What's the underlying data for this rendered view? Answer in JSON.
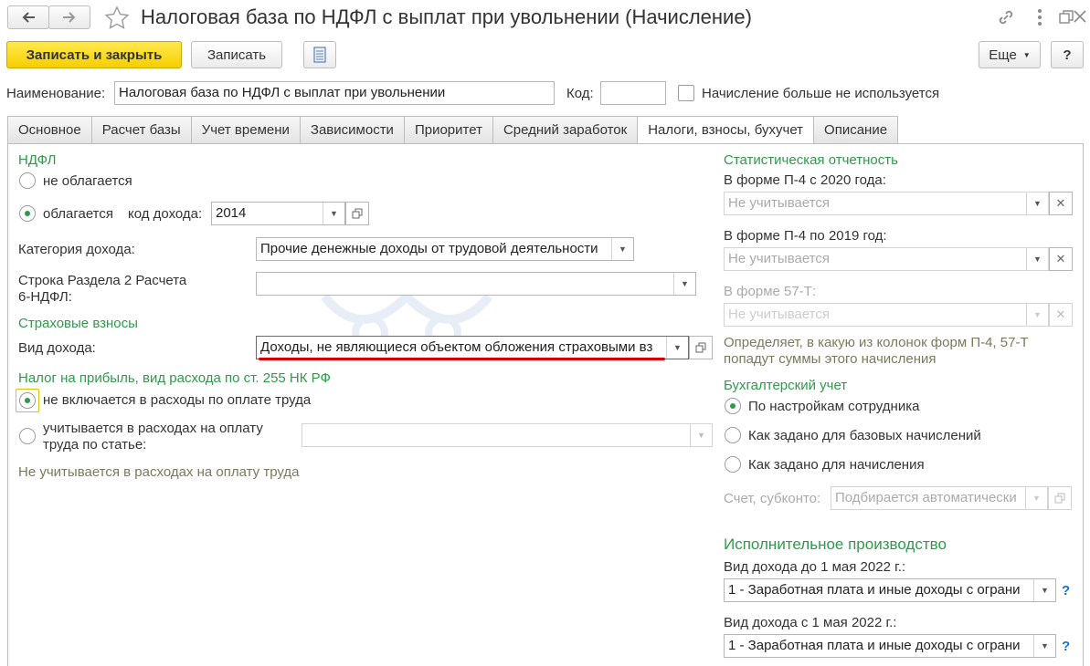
{
  "window": {
    "title": "Налоговая база по НДФЛ с выплат при увольнении (Начисление)",
    "back_icon": "arrow-left-icon",
    "forward_icon": "arrow-right-icon",
    "star_icon": "star-icon",
    "link_icon": "link-icon",
    "menu_icon": "more-vertical-icon",
    "restore_icon": "restore-icon",
    "close_icon": "close-icon"
  },
  "toolbar": {
    "save_close_label": "Записать и закрыть",
    "save_label": "Записать",
    "report_icon": "document-list-icon",
    "more_label": "Еще",
    "help_label": "?"
  },
  "header": {
    "name_label": "Наименование:",
    "name_value": "Налоговая база по НДФЛ с выплат при увольнении",
    "code_label": "Код:",
    "code_value": "",
    "unused_label": "Начисление больше не используется"
  },
  "tabs": [
    {
      "label": "Основное"
    },
    {
      "label": "Расчет базы"
    },
    {
      "label": "Учет времени"
    },
    {
      "label": "Зависимости"
    },
    {
      "label": "Приоритет"
    },
    {
      "label": "Средний заработок"
    },
    {
      "label": "Налоги, взносы, бухучет"
    },
    {
      "label": "Описание"
    }
  ],
  "ndfl": {
    "section": "НДФЛ",
    "not_taxed_label": "не облагается",
    "taxed_label": "облагается",
    "income_code_label": "код дохода:",
    "income_code_value": "2014",
    "category_label": "Категория дохода:",
    "category_value": "Прочие денежные доходы от трудовой деятельности",
    "row_label_1": "Строка Раздела 2 Расчета",
    "row_label_2": "6-НДФЛ:",
    "row_value": ""
  },
  "insurance": {
    "section": "Страховые взносы",
    "income_type_label": "Вид дохода:",
    "income_type_value": "Доходы, не являющиеся объектом обложения страховыми вз"
  },
  "profit_tax": {
    "section": "Налог на прибыль, вид расхода по ст. 255 НК РФ",
    "not_included_label": "не включается в расходы по оплате труда",
    "included_label_1": "учитывается в расходах на оплату",
    "included_label_2": "труда по статье:",
    "hint": "Не учитывается в расходах на оплату труда"
  },
  "stats": {
    "section": "Статистическая отчетность",
    "p4_2020_label": "В форме П-4 с 2020 года:",
    "p4_2020_value": "Не учитывается",
    "p4_2019_label": "В форме П-4 по 2019 год:",
    "p4_2019_value": "Не учитывается",
    "f57_label": "В форме 57-Т:",
    "f57_value": "Не учитывается",
    "hint_1": "Определяет, в какую из колонок форм П-4, 57-Т",
    "hint_2": "попадут суммы этого начисления"
  },
  "accounting": {
    "section": "Бухгалтерский учет",
    "by_employee_label": "По настройкам сотрудника",
    "as_base_label": "Как задано для базовых начислений",
    "as_accrual_label": "Как задано для начисления",
    "account_label": "Счет, субконто:",
    "account_value": "Подбирается автоматически"
  },
  "enforcement": {
    "section": "Исполнительное производство",
    "before_label": "Вид дохода до 1 мая 2022 г.:",
    "before_value": "1 - Заработная плата и иные доходы с ограни",
    "after_label": "Вид дохода с 1 мая 2022 г.:",
    "after_value": "1 - Заработная плата и иные доходы с ограни",
    "help_label": "?"
  },
  "colors": {
    "section_green": "#2e9a4a",
    "primary_yellow": "#f6cf00",
    "underline_red": "#d40000"
  }
}
